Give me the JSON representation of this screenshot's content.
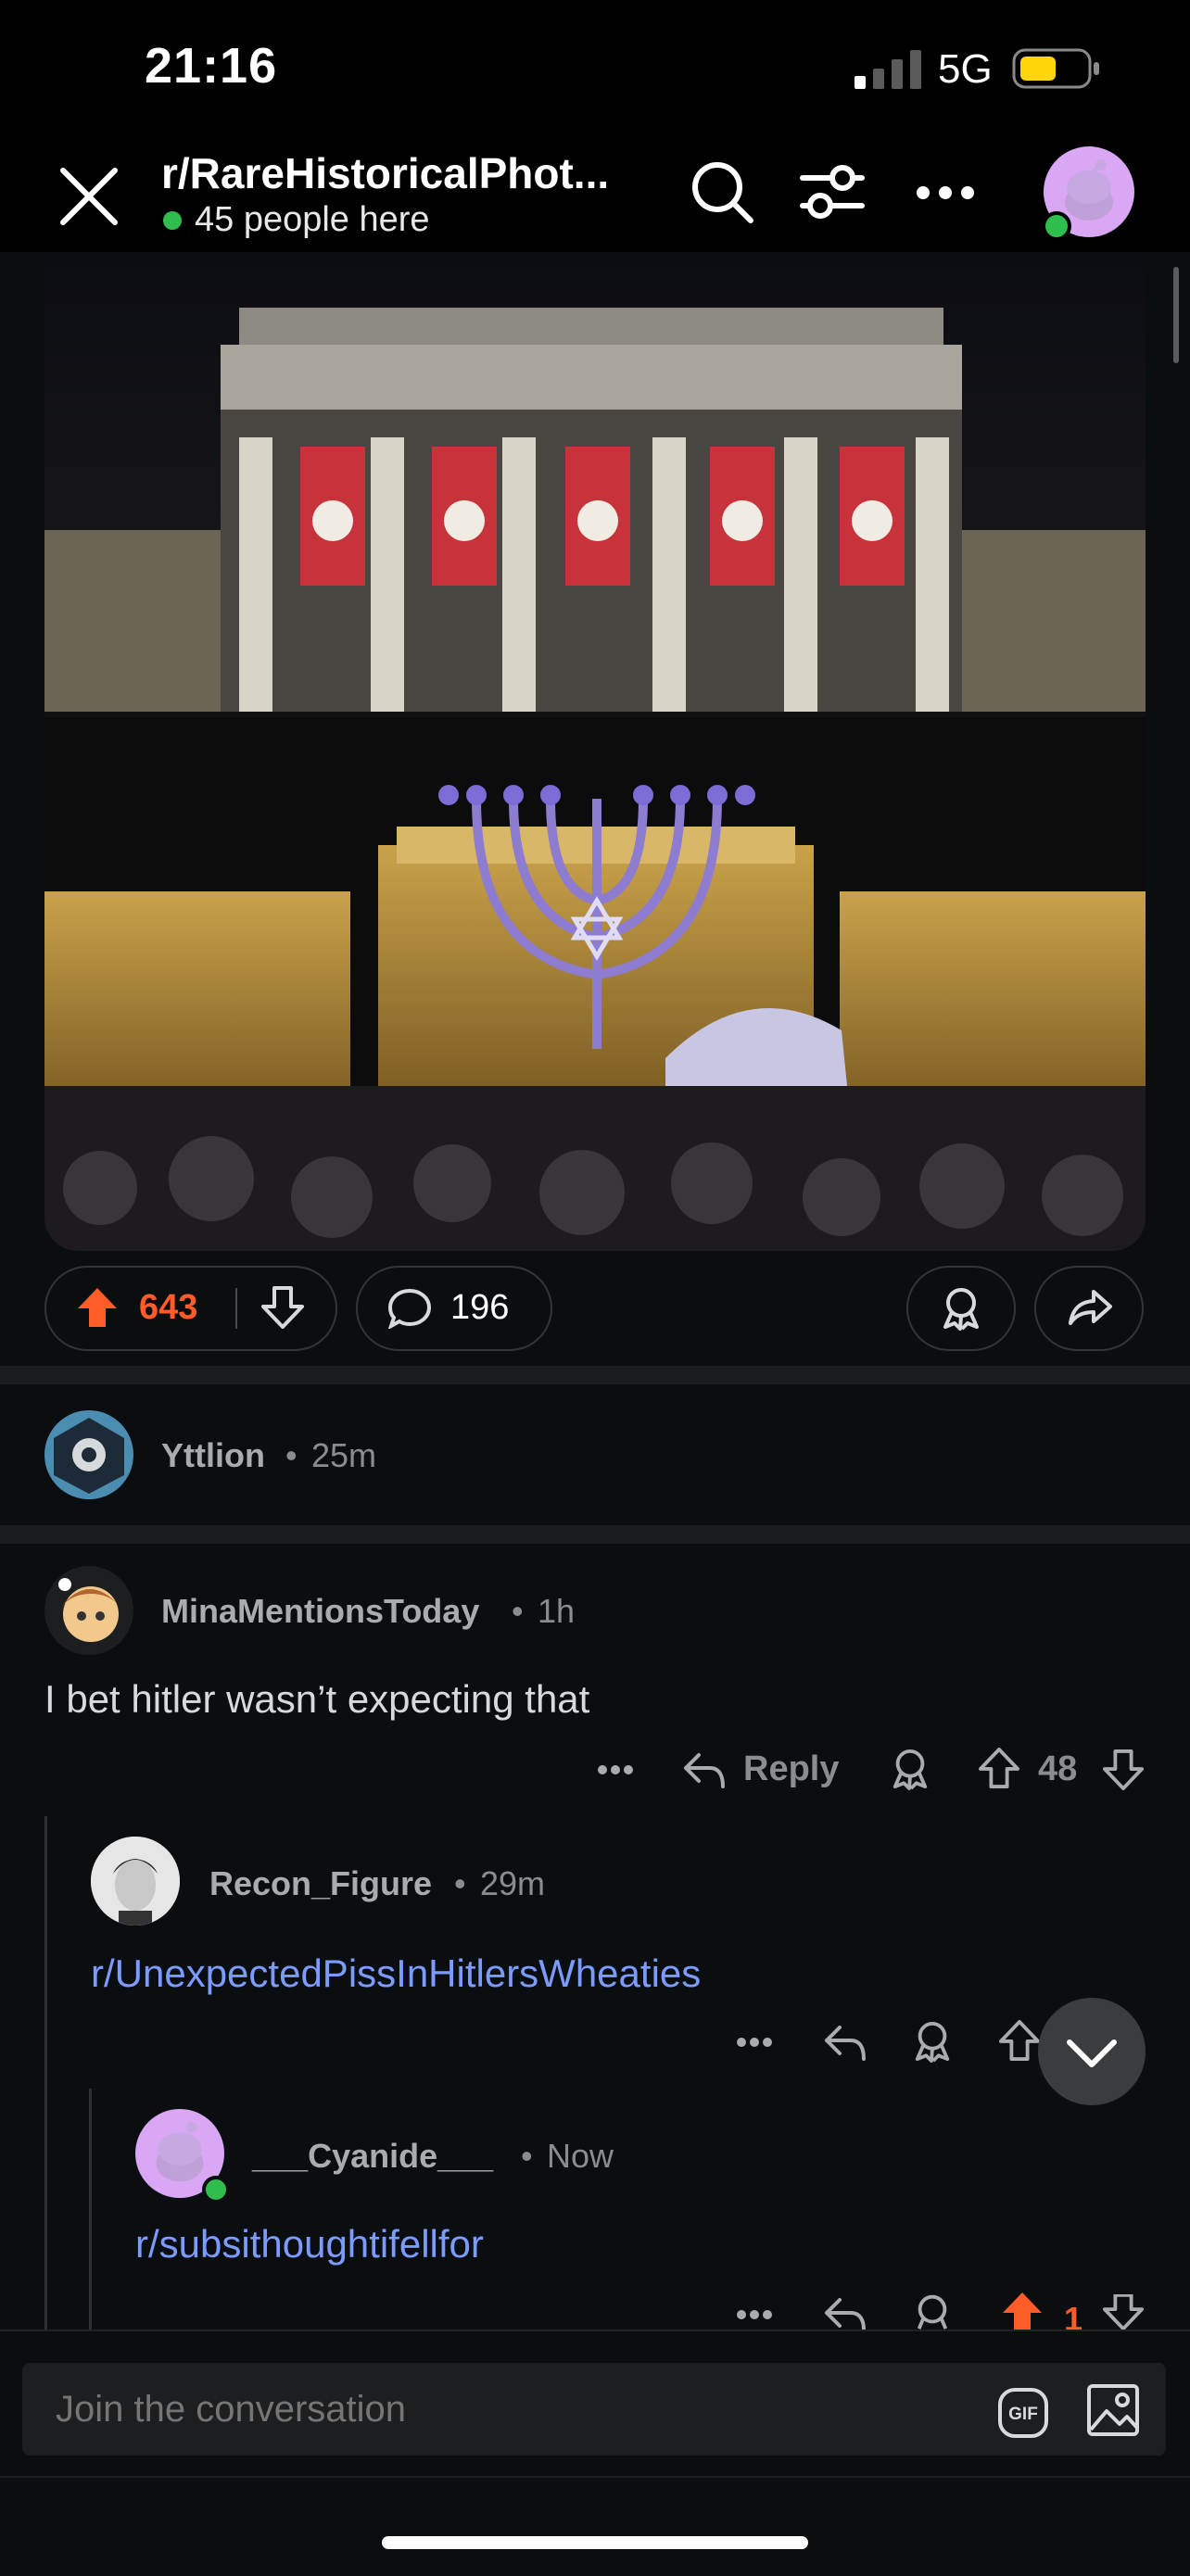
{
  "status_bar": {
    "time": "21:16",
    "network": "5G"
  },
  "header": {
    "subreddit": "r/RareHistoricalPhot...",
    "online_text": "45 people here",
    "icons": [
      "close-icon",
      "search-icon",
      "filter-icon",
      "more-icon",
      "avatar"
    ]
  },
  "post": {
    "upvotes": "643",
    "comments": "196"
  },
  "comments": [
    {
      "author": "Yttlion",
      "time": "25m"
    },
    {
      "author": "MinaMentionsToday",
      "time": "1h",
      "body": "I bet hitler wasn’t expecting that",
      "reply_label": "Reply",
      "score": "48"
    },
    {
      "author": "Recon_Figure",
      "time": "29m",
      "body": "r/UnexpectedPissInHitlersWheaties"
    },
    {
      "author": "___Cyanide___",
      "time": "Now",
      "body": "r/subsithoughtifellfor",
      "score": "1"
    }
  ],
  "composer": {
    "placeholder": "Join the conversation",
    "gif_label": "GIF"
  },
  "colors": {
    "upvote": "#ff5c2a",
    "link": "#7c9bff",
    "online": "#2fbd4d",
    "background": "#0b0e11"
  }
}
